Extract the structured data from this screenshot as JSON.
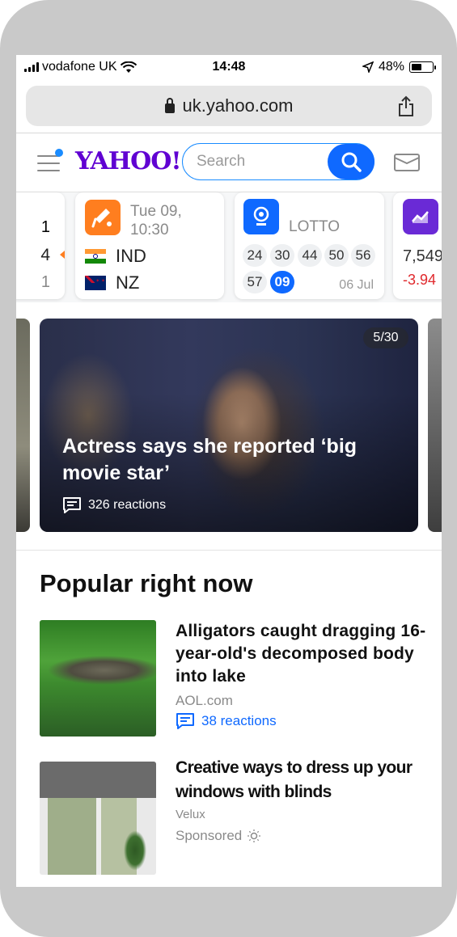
{
  "status_bar": {
    "carrier": "vodafone UK",
    "time": "14:48",
    "battery": "48%"
  },
  "browser": {
    "url": "uk.yahoo.com"
  },
  "header": {
    "logo": "YAHOO!",
    "search_placeholder": "Search",
    "icons": [
      "hamburger-menu-icon",
      "search-icon",
      "mail-icon"
    ],
    "notification_dot_color": "#1a8cff"
  },
  "scoreboard": {
    "partial_card": {
      "top": "1",
      "middle": "4",
      "bottom": "1"
    },
    "cricket": {
      "date": "Tue 09,",
      "time": "10:30",
      "team1": "IND",
      "team2": "NZ"
    },
    "lotto": {
      "label": "LOTTO",
      "numbers": [
        "24",
        "30",
        "44",
        "50",
        "56",
        "57"
      ],
      "bonus": "09",
      "draw_date": "06 Jul"
    },
    "markets": {
      "value": "7,549",
      "change": "-3.94"
    }
  },
  "hero": {
    "counter": "5/30",
    "title": "Actress says she reported ‘big movie star’",
    "reactions": "326 reactions"
  },
  "popular": {
    "heading": "Popular right now",
    "items": [
      {
        "headline": "Alligators caught dragging 16-year-old's decomposed body into lake",
        "source": "AOL.com",
        "reactions": "38 reactions"
      },
      {
        "headline": "Creative ways to dress up your windows with blinds",
        "source": "Velux",
        "sponsored": "Sponsored"
      }
    ]
  },
  "colors": {
    "yahoo_purple": "#6001d2",
    "accent_blue": "#0f69ff",
    "negative_red": "#e0292d",
    "cricket_orange": "#ff7e1f"
  }
}
